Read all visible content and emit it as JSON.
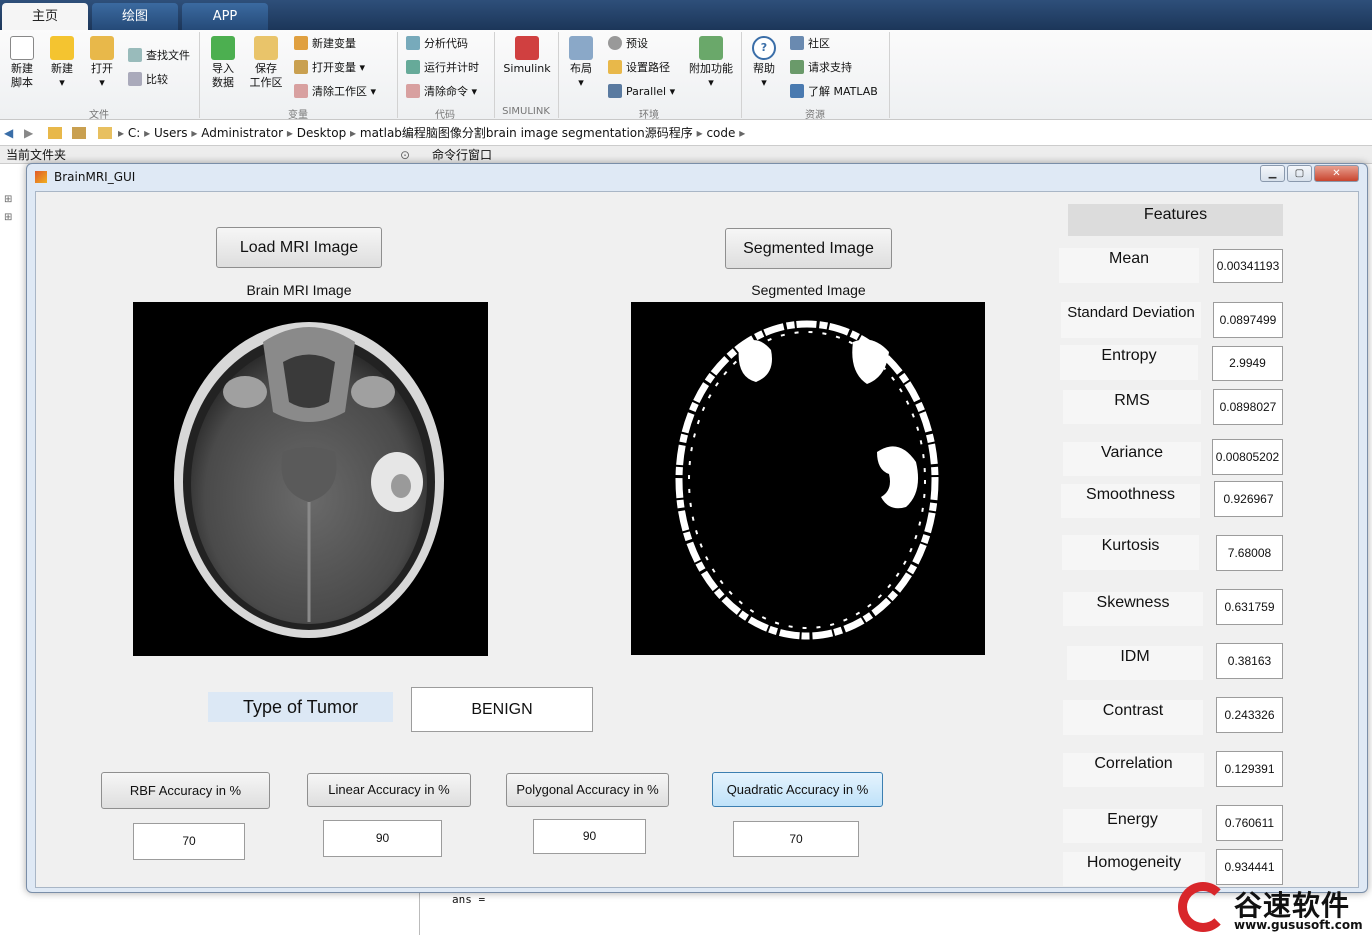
{
  "tabs": [
    "主页",
    "绘图",
    "APP"
  ],
  "ribbon": {
    "new_script": "新建\n脚本",
    "new": "新建",
    "open": "打开",
    "find_files": "查找文件",
    "compare": "比较",
    "import_data": "导入\n数据",
    "save_workspace": "保存\n工作区",
    "new_variable": "新建变量",
    "open_variable": "打开变量",
    "clear_workspace": "清除工作区",
    "analyze_code": "分析代码",
    "run_and_time": "运行并计时",
    "clear_commands": "清除命令",
    "simulink": "Simulink",
    "layout": "布局",
    "preferences": "预设",
    "set_path": "设置路径",
    "parallel": "Parallel",
    "add_ons": "附加功能",
    "help": "帮助",
    "community": "社区",
    "request_support": "请求支持",
    "learn_matlab": "了解 MATLAB",
    "sections": [
      "文件",
      "变量",
      "代码",
      "SIMULINK",
      "环境",
      "资源"
    ]
  },
  "address": {
    "path": [
      "C:",
      "Users",
      "Administrator",
      "Desktop",
      "matlab编程脑图像分割brain image segmentation源码程序",
      "code"
    ]
  },
  "panels": {
    "current_folder": "当前文件夹",
    "command_window": "命令行窗口",
    "cmd_text": "ans ="
  },
  "window": {
    "title": "BrainMRI_GUI"
  },
  "gui": {
    "load_button": "Load MRI Image",
    "segment_button": "Segmented Image",
    "brain_caption": "Brain MRI Image",
    "segmented_caption": "Segmented Image",
    "tumor_label": "Type of Tumor",
    "tumor_value": "BENIGN",
    "accuracy": [
      {
        "label": "RBF Accuracy in %",
        "value": "70"
      },
      {
        "label": "Linear Accuracy in %",
        "value": "90"
      },
      {
        "label": "Polygonal Accuracy in %",
        "value": "90"
      },
      {
        "label": "Quadratic Accuracy in %",
        "value": "70"
      }
    ],
    "features_title": "Features",
    "features": [
      {
        "name": "Mean",
        "value": "0.00341193"
      },
      {
        "name": "Standard Deviation",
        "value": "0.0897499"
      },
      {
        "name": "Entropy",
        "value": "2.9949"
      },
      {
        "name": "RMS",
        "value": "0.0898027"
      },
      {
        "name": "Variance",
        "value": "0.00805202"
      },
      {
        "name": "Smoothness",
        "value": "0.926967"
      },
      {
        "name": "Kurtosis",
        "value": "7.68008"
      },
      {
        "name": "Skewness",
        "value": "0.631759"
      },
      {
        "name": "IDM",
        "value": "0.38163"
      },
      {
        "name": "Contrast",
        "value": "0.243326"
      },
      {
        "name": "Correlation",
        "value": "0.129391"
      },
      {
        "name": "Energy",
        "value": "0.760611"
      },
      {
        "name": "Homogeneity",
        "value": "0.934441"
      }
    ]
  },
  "watermark": {
    "brand": "谷速软件",
    "url": "www.gususoft.com"
  }
}
